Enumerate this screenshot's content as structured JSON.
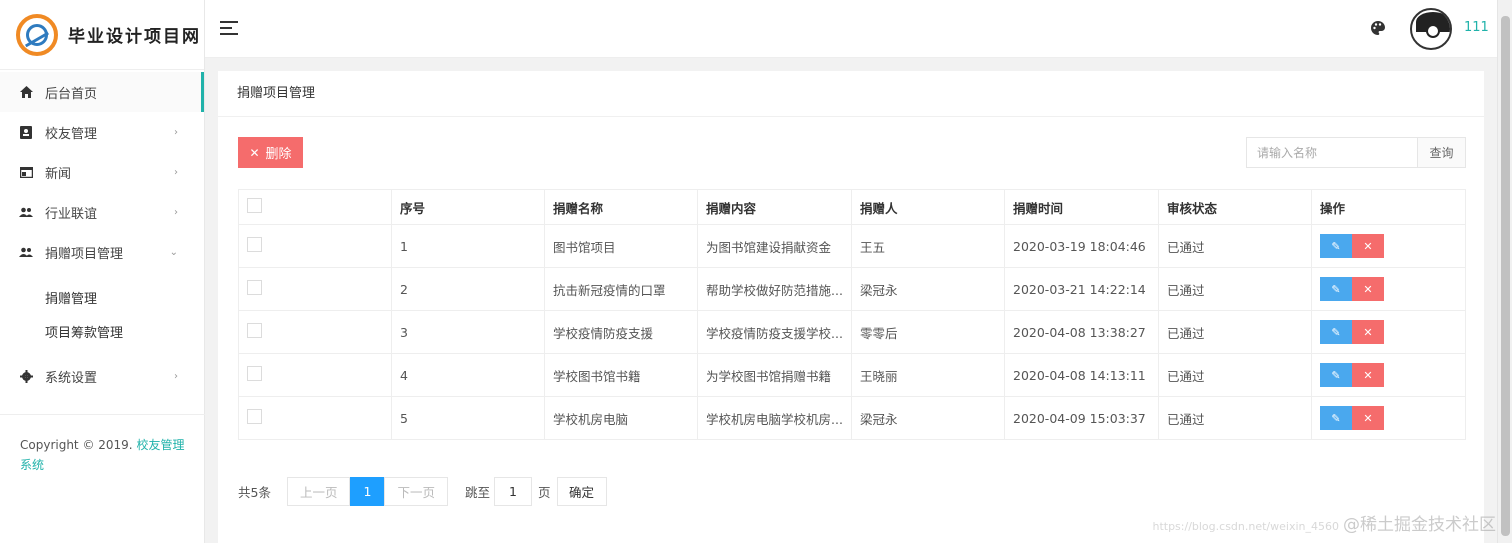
{
  "brand": {
    "title": "毕业设计项目网"
  },
  "sidebar": {
    "items": [
      {
        "label": "后台首页"
      },
      {
        "label": "校友管理"
      },
      {
        "label": "新闻"
      },
      {
        "label": "行业联谊"
      },
      {
        "label": "捐赠项目管理"
      },
      {
        "label": "系统设置"
      }
    ],
    "submenu": [
      {
        "label": "捐赠管理"
      },
      {
        "label": "项目筹款管理"
      }
    ],
    "footer_text": "Copyright © 2019. ",
    "footer_link": "校友管理系统"
  },
  "header": {
    "username": "111"
  },
  "page": {
    "title": "捐赠项目管理",
    "delete_label": "删除",
    "search_placeholder": "请输入名称",
    "query_label": "查询"
  },
  "table": {
    "headers": [
      "序号",
      "捐赠名称",
      "捐赠内容",
      "捐赠人",
      "捐赠时间",
      "审核状态",
      "操作"
    ],
    "rows": [
      [
        "1",
        "图书馆项目",
        "为图书馆建设捐献资金",
        "王五",
        "2020-03-19 18:04:46",
        "已通过"
      ],
      [
        "2",
        "抗击新冠疫情的口罩",
        "帮助学校做好防范措施...",
        "梁冠永",
        "2020-03-21 14:22:14",
        "已通过"
      ],
      [
        "3",
        "学校疫情防疫支援",
        "学校疫情防疫支援学校...",
        "零零后",
        "2020-04-08 13:38:27",
        "已通过"
      ],
      [
        "4",
        "学校图书馆书籍",
        "为学校图书馆捐赠书籍",
        "王晓丽",
        "2020-04-08 14:13:11",
        "已通过"
      ],
      [
        "5",
        "学校机房电脑",
        "学校机房电脑学校机房...",
        "梁冠永",
        "2020-04-09 15:03:37",
        "已通过"
      ]
    ]
  },
  "pager": {
    "total": "共5条",
    "prev": "上一页",
    "current": "1",
    "next": "下一页",
    "jump_to": "跳至",
    "jump_value": "1",
    "unit": "页",
    "confirm": "确定"
  },
  "watermark": {
    "url": "https://blog.csdn.net/weixin_4560",
    "text": "@稀土掘金技术社区"
  },
  "colors": {
    "accent": "#20b2aa",
    "danger": "#f56c6c",
    "primary": "#1e9fff",
    "edit": "#4aa8ee"
  }
}
